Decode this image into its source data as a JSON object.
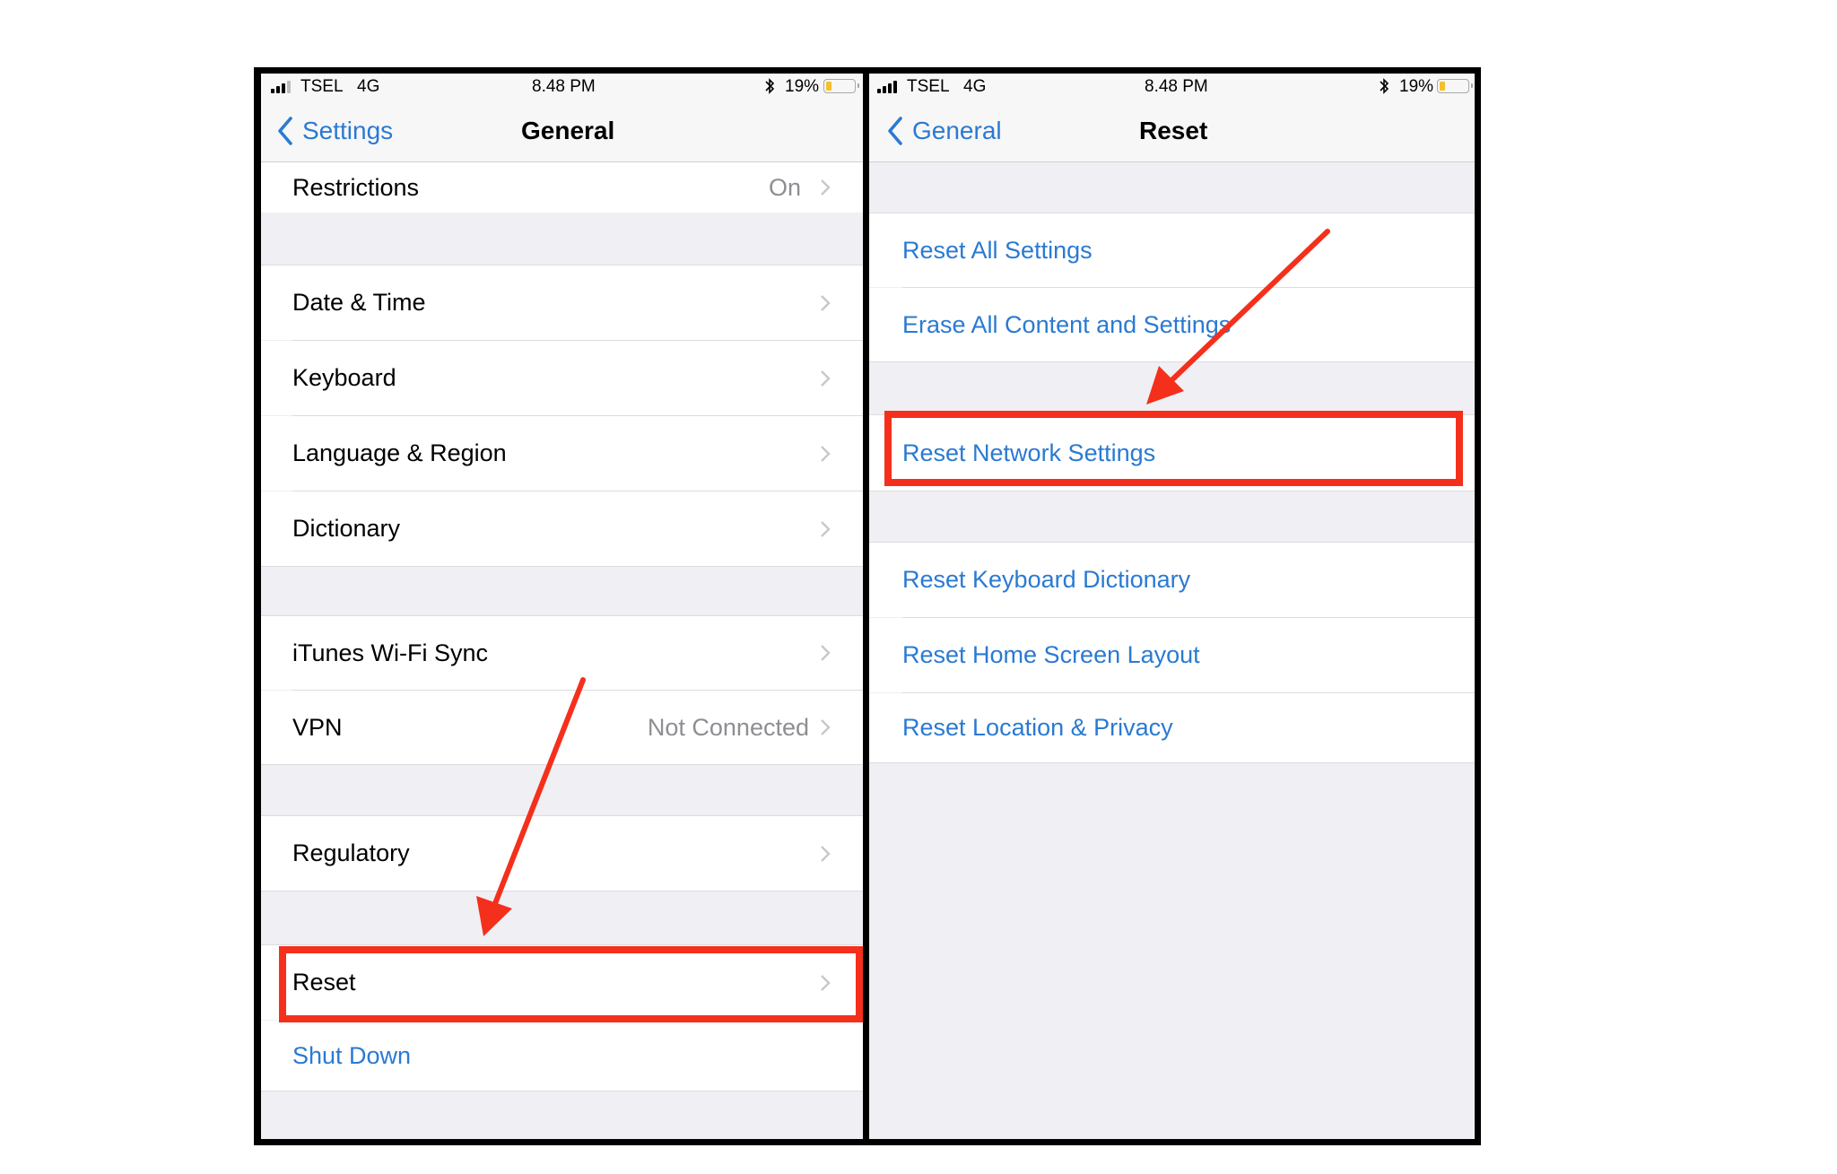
{
  "left_screen": {
    "status_bar": {
      "carrier": "TSEL",
      "network": "4G",
      "time": "8.48 PM",
      "battery": "19%",
      "battery_level": 0.19,
      "signal_bars": 3
    },
    "nav": {
      "back_label": "Settings",
      "title": "General"
    },
    "rows": [
      {
        "label": "Restrictions",
        "value": "On"
      },
      {
        "label": "Date & Time"
      },
      {
        "label": "Keyboard"
      },
      {
        "label": "Language & Region"
      },
      {
        "label": "Dictionary"
      },
      {
        "label": "iTunes Wi-Fi Sync"
      },
      {
        "label": "VPN",
        "value": "Not Connected"
      },
      {
        "label": "Regulatory"
      },
      {
        "label": "Reset"
      },
      {
        "label": "Shut Down"
      }
    ]
  },
  "right_screen": {
    "status_bar": {
      "carrier": "TSEL",
      "network": "4G",
      "time": "8.48 PM",
      "battery": "19%",
      "battery_level": 0.19,
      "signal_bars": 4
    },
    "nav": {
      "back_label": "General",
      "title": "Reset"
    },
    "rows": [
      {
        "label": "Reset All Settings"
      },
      {
        "label": "Erase All Content and Settings"
      },
      {
        "label": "Reset Network Settings"
      },
      {
        "label": "Reset Keyboard Dictionary"
      },
      {
        "label": "Reset Home Screen Layout"
      },
      {
        "label": "Reset Location & Privacy"
      }
    ]
  },
  "annotations": {
    "highlight_color": "#f4301c",
    "highlighted_left": "Reset",
    "highlighted_right": "Reset Network Settings"
  },
  "colors": {
    "ios_blue": "#2a7ad2",
    "group_background": "#efeff4",
    "nav_background": "#f7f7f7",
    "secondary_text": "#8e8e93",
    "chevron": "#c7c7cc"
  }
}
